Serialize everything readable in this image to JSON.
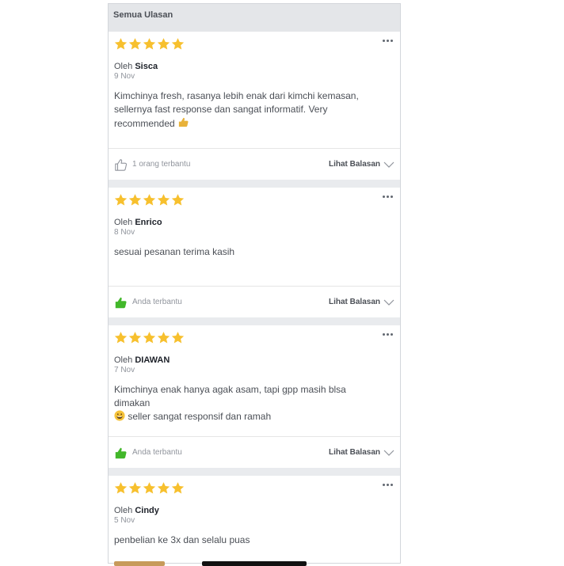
{
  "header": {
    "title": "Semua Ulasan"
  },
  "colors": {
    "star": "#f7c02e",
    "like_active": "#42b72a",
    "like_inactive": "#90949c"
  },
  "reviews": [
    {
      "rating": 5,
      "author_prefix": "Oleh",
      "author": "Sisca",
      "date": "9 Nov",
      "text": "Kimchinya fresh, rasanya lebih enak dari kimchi kemasan, sellernya fast response dan sangat informatif. Very recommended",
      "emoji": "thumbs-up-emoji",
      "helpful": "1 orang terbantu",
      "helpful_active": false,
      "replies": "Lihat Balasan"
    },
    {
      "rating": 5,
      "author_prefix": "Oleh",
      "author": "Enrico",
      "date": "8 Nov",
      "text": "sesuai pesanan terima kasih",
      "helpful": "Anda terbantu",
      "helpful_active": true,
      "replies": "Lihat Balasan"
    },
    {
      "rating": 5,
      "author_prefix": "Oleh",
      "author": "DIAWAN",
      "date": "7 Nov",
      "text_line1": "Kimchinya enak hanya agak asam, tapi gpp masih blsa dimakan",
      "text_line2": "seller sangat responsif dan ramah",
      "emoji": "grinning-face-emoji",
      "helpful": "Anda terbantu",
      "helpful_active": true,
      "replies": "Lihat Balasan"
    },
    {
      "rating": 5,
      "author_prefix": "Oleh",
      "author": "Cindy",
      "date": "5 Nov",
      "text": "penbelian ke 3x dan selalu puas"
    }
  ]
}
